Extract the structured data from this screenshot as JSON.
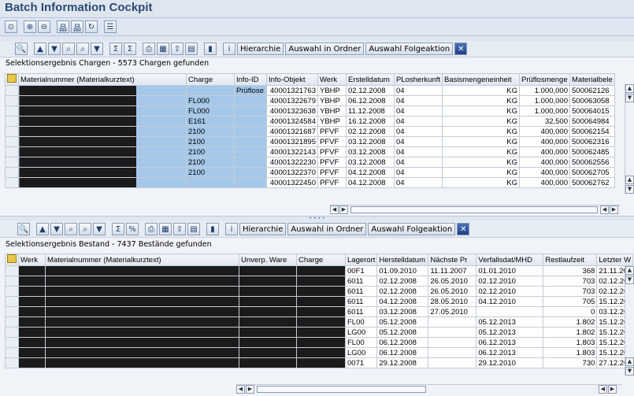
{
  "title": "Batch Information Cockpit",
  "appbar": {
    "icons": [
      "clock-icon",
      "zoom-in-icon",
      "zoom-out-icon",
      "tree-icon",
      "hierarchy-icon",
      "refresh-icon",
      "list-icon"
    ]
  },
  "top": {
    "toolbar": {
      "hierarchy": "Hierarchie",
      "auswahl_ordner": "Auswahl in Ordner",
      "auswahl_folge": "Auswahl Folgeaktion"
    },
    "caption": "Selektionsergebnis Chargen - 5573 Chargen gefunden",
    "columns": [
      "Materialnummer (Materialkurztext)",
      "Charge",
      "Info-ID",
      "Info-Objekt",
      "Werk",
      "Erstelldatum",
      "PLosherkunft",
      "Basismengeneinheit",
      "Prüflosmenge",
      "Materialbele"
    ],
    "rows": [
      {
        "material": "",
        "charge": "",
        "infoid": "Prüflose",
        "objekt": "40001321763",
        "werk": "YBHP",
        "datum": "02.12.2008",
        "herk": "04",
        "einheit": "KG",
        "menge": "1.000,000",
        "beleg": "500062126"
      },
      {
        "material": "",
        "charge": "FL000",
        "infoid": "",
        "objekt": "40001322679",
        "werk": "YBHP",
        "datum": "06.12.2008",
        "herk": "04",
        "einheit": "KG",
        "menge": "1.000,000",
        "beleg": "500063058"
      },
      {
        "material": "",
        "charge": "FL000",
        "infoid": "",
        "objekt": "40001323638",
        "werk": "YBHP",
        "datum": "11.12.2008",
        "herk": "04",
        "einheit": "KG",
        "menge": "1.000,000",
        "beleg": "500064015"
      },
      {
        "material": "",
        "charge": "E161",
        "infoid": "",
        "objekt": "40001324584",
        "werk": "YBHP",
        "datum": "16.12.2008",
        "herk": "04",
        "einheit": "KG",
        "menge": "32,500",
        "beleg": "500064984"
      },
      {
        "material": "",
        "charge": "2100",
        "infoid": "",
        "objekt": "40001321687",
        "werk": "PFVF",
        "datum": "02.12.2008",
        "herk": "04",
        "einheit": "KG",
        "menge": "400,000",
        "beleg": "500062154"
      },
      {
        "material": "",
        "charge": "2100",
        "infoid": "",
        "objekt": "40001321895",
        "werk": "PFVF",
        "datum": "03.12.2008",
        "herk": "04",
        "einheit": "KG",
        "menge": "400,000",
        "beleg": "500062316"
      },
      {
        "material": "",
        "charge": "2100",
        "infoid": "",
        "objekt": "40001322143",
        "werk": "PFVF",
        "datum": "03.12.2008",
        "herk": "04",
        "einheit": "KG",
        "menge": "400,000",
        "beleg": "500062485"
      },
      {
        "material": "",
        "charge": "2100",
        "infoid": "",
        "objekt": "40001322230",
        "werk": "PFVF",
        "datum": "03.12.2008",
        "herk": "04",
        "einheit": "KG",
        "menge": "400,000",
        "beleg": "500062556"
      },
      {
        "material": "",
        "charge": "2100",
        "infoid": "",
        "objekt": "40001322370",
        "werk": "PFVF",
        "datum": "04.12.2008",
        "herk": "04",
        "einheit": "KG",
        "menge": "400,000",
        "beleg": "500062705"
      },
      {
        "material": "",
        "charge": "",
        "infoid": "",
        "objekt": "40001322450",
        "werk": "PFVF",
        "datum": "04.12.2008",
        "herk": "04",
        "einheit": "KG",
        "menge": "400,000",
        "beleg": "500062762"
      }
    ]
  },
  "bottom": {
    "toolbar": {
      "hierarchy": "Hierarchie",
      "auswahl_ordner": "Auswahl in Ordner",
      "auswahl_folge": "Auswahl Folgeaktion"
    },
    "caption": "Selektionsergebnis Bestand - 7437 Bestände gefunden",
    "columns": [
      "Werk",
      "Materialnummer (Materialkurztext)",
      "Unverp. Ware",
      "Charge",
      "Lagerort",
      "Herstelldatum",
      "Nächste Pr",
      "Verfallsdat/MHD",
      "Restlaufzeit",
      "Letzter W"
    ],
    "rows": [
      {
        "lagerort": "00F1",
        "herstell": "01.09.2010",
        "naechste": "11.11.2007",
        "verfall": "01.01.2010",
        "rest": "368",
        "letzter": "21.11.20"
      },
      {
        "lagerort": "6011",
        "herstell": "02.12.2008",
        "naechste": "26.05.2010",
        "verfall": "02.12.2010",
        "rest": "703",
        "letzter": "02.12.20"
      },
      {
        "lagerort": "6011",
        "herstell": "02.12.2008",
        "naechste": "26.05.2010",
        "verfall": "02.12.2010",
        "rest": "703",
        "letzter": "02.12.20"
      },
      {
        "lagerort": "6011",
        "herstell": "04.12.2008",
        "naechste": "28.05.2010",
        "verfall": "04.12.2010",
        "rest": "705",
        "letzter": "15.12.20"
      },
      {
        "lagerort": "6011",
        "herstell": "03.12.2008",
        "naechste": "27.05.2010",
        "verfall": "",
        "rest": "0",
        "letzter": "03.12.20"
      },
      {
        "lagerort": "FL00",
        "herstell": "05.12.2008",
        "naechste": "",
        "verfall": "05.12.2013",
        "rest": "1.802",
        "letzter": "15.12.20"
      },
      {
        "lagerort": "LG00",
        "herstell": "05.12.2008",
        "naechste": "",
        "verfall": "05.12.2013",
        "rest": "1.802",
        "letzter": "15.12.20"
      },
      {
        "lagerort": "FL00",
        "herstell": "06.12.2008",
        "naechste": "",
        "verfall": "06.12.2013",
        "rest": "1.803",
        "letzter": "15.12.20"
      },
      {
        "lagerort": "LG00",
        "herstell": "06.12.2008",
        "naechste": "",
        "verfall": "06.12.2013",
        "rest": "1.803",
        "letzter": "15.12.20"
      },
      {
        "lagerort": "0071",
        "herstell": "29.12.2008",
        "naechste": "",
        "verfall": "29.12.2010",
        "rest": "730",
        "letzter": "27.12.20"
      }
    ]
  }
}
